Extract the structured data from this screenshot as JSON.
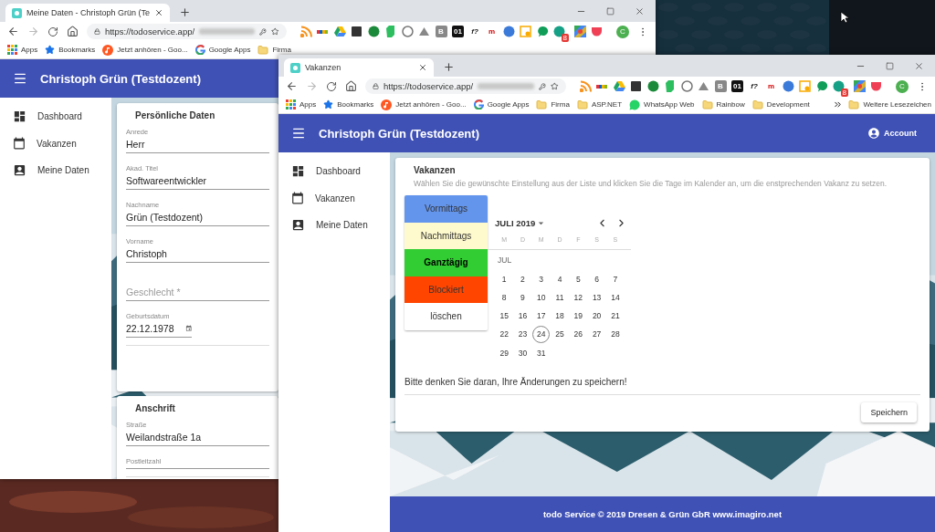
{
  "windows": [
    {
      "tab_title": "Meine Daten - Christoph Grün (Te",
      "url": "https://todoservice.app/",
      "avatar": "C",
      "extensions": [
        {
          "kind": "rss"
        },
        {
          "kind": "bars"
        },
        {
          "kind": "triangle"
        },
        {
          "kind": "dark-square"
        },
        {
          "kind": "green-circle"
        },
        {
          "kind": "leaf"
        },
        {
          "kind": "grey-circle"
        },
        {
          "kind": "cloud"
        },
        {
          "kind": "tile",
          "label": "B"
        },
        {
          "kind": "dark-tile",
          "label": "01"
        },
        {
          "kind": "italic",
          "label": "f?"
        },
        {
          "kind": "red",
          "label": "m"
        },
        {
          "kind": "globe"
        },
        {
          "kind": "yellow-square"
        },
        {
          "kind": "bubble"
        },
        {
          "kind": "badge",
          "label": "8"
        },
        {
          "kind": "colorful"
        },
        {
          "kind": "pocket"
        }
      ],
      "bookmarks": [
        {
          "kind": "apps",
          "label": "Apps"
        },
        {
          "kind": "star",
          "label": "Bookmarks"
        },
        {
          "kind": "music",
          "label": "Jetzt anhören - Goo..."
        },
        {
          "kind": "google",
          "label": "Google Apps"
        },
        {
          "kind": "folder",
          "label": "Firma"
        }
      ],
      "app_title": "Christoph Grün (Testdozent)",
      "nav": [
        {
          "kind": "dashboard",
          "label": "Dashboard"
        },
        {
          "kind": "calendar",
          "label": "Vakanzen"
        },
        {
          "kind": "person",
          "label": "Meine Daten"
        }
      ],
      "page": {
        "kind": "profile",
        "cards": [
          {
            "title": "Persönliche Daten",
            "fields": [
              {
                "kind": "text",
                "label": "Anrede",
                "value": "Herr"
              },
              {
                "kind": "text",
                "label": "Akad. Titel",
                "value": "Softwareentwickler"
              },
              {
                "kind": "text",
                "label": "Nachname",
                "value": "Grün (Testdozent)"
              },
              {
                "kind": "text",
                "label": "Vorname",
                "value": "Christoph"
              },
              {
                "kind": "select",
                "placeholder": "Geschlecht *"
              },
              {
                "kind": "date",
                "label": "Geburtsdatum",
                "value": "22.12.1978"
              }
            ]
          },
          {
            "title": "Anschrift",
            "fields": [
              {
                "kind": "text",
                "label": "Straße",
                "value": "Weilandstraße 1a"
              },
              {
                "kind": "text",
                "label": "Postleitzahl"
              }
            ]
          }
        ]
      }
    },
    {
      "tab_title": "Vakanzen",
      "url": "https://todoservice.app/",
      "avatar": "C",
      "extensions": [
        {
          "kind": "rss"
        },
        {
          "kind": "bars"
        },
        {
          "kind": "triangle"
        },
        {
          "kind": "dark-square"
        },
        {
          "kind": "green-circle"
        },
        {
          "kind": "leaf"
        },
        {
          "kind": "grey-circle"
        },
        {
          "kind": "cloud"
        },
        {
          "kind": "tile",
          "label": "B"
        },
        {
          "kind": "dark-tile",
          "label": "01"
        },
        {
          "kind": "italic",
          "label": "f?"
        },
        {
          "kind": "red",
          "label": "m"
        },
        {
          "kind": "globe"
        },
        {
          "kind": "yellow-square"
        },
        {
          "kind": "bubble"
        },
        {
          "kind": "badge",
          "label": "8"
        },
        {
          "kind": "colorful"
        },
        {
          "kind": "pocket"
        }
      ],
      "bookmarks": [
        {
          "kind": "apps",
          "label": "Apps"
        },
        {
          "kind": "star",
          "label": "Bookmarks"
        },
        {
          "kind": "music",
          "label": "Jetzt anhören - Goo..."
        },
        {
          "kind": "google",
          "label": "Google Apps"
        },
        {
          "kind": "folder",
          "label": "Firma"
        },
        {
          "kind": "folder",
          "label": "ASP.NET"
        },
        {
          "kind": "whatsapp",
          "label": "WhatsApp Web"
        },
        {
          "kind": "folder",
          "label": "Rainbow"
        },
        {
          "kind": "folder",
          "label": "Development"
        }
      ],
      "other_bookmarks": "Weitere Lesezeichen",
      "app_title": "Christoph Grün (Testdozent)",
      "account": "Account",
      "nav": [
        {
          "kind": "dashboard",
          "label": "Dashboard"
        },
        {
          "kind": "calendar",
          "label": "Vakanzen"
        },
        {
          "kind": "person",
          "label": "Meine Daten"
        }
      ],
      "page": {
        "kind": "vacancies",
        "title": "Vakanzen",
        "description": "Wählen Sie die gewünschte Einstellung aus der Liste und klicken Sie die Tage im Kalender an, um die enstprechenden Vakanz zu setzen.",
        "options": [
          {
            "label": "Vormittags",
            "color": "#6495ed",
            "selected": false
          },
          {
            "label": "Nachmittags",
            "color": "#fffacd",
            "selected": false
          },
          {
            "label": "Ganztägig",
            "color": "#32cd32",
            "selected": true
          },
          {
            "label": "Blockiert",
            "color": "#ff4500",
            "selected": false
          },
          {
            "label": "löschen",
            "color": "#ffffff",
            "selected": false
          }
        ],
        "calendar": {
          "month": "JULI 2019",
          "weekdays": [
            "M",
            "D",
            "M",
            "D",
            "F",
            "S",
            "S"
          ],
          "month_short": "JUL",
          "days": [
            {
              "day": "1",
              "today": false
            },
            {
              "day": "2",
              "today": false
            },
            {
              "day": "3",
              "today": false
            },
            {
              "day": "4",
              "today": false
            },
            {
              "day": "5",
              "today": false
            },
            {
              "day": "6",
              "today": false
            },
            {
              "day": "7",
              "today": false
            },
            {
              "day": "8",
              "today": false
            },
            {
              "day": "9",
              "today": false
            },
            {
              "day": "10",
              "today": false
            },
            {
              "day": "11",
              "today": false
            },
            {
              "day": "12",
              "today": false
            },
            {
              "day": "13",
              "today": false
            },
            {
              "day": "14",
              "today": false
            },
            {
              "day": "15",
              "today": false
            },
            {
              "day": "16",
              "today": false
            },
            {
              "day": "17",
              "today": false
            },
            {
              "day": "18",
              "today": false
            },
            {
              "day": "19",
              "today": false
            },
            {
              "day": "20",
              "today": false
            },
            {
              "day": "21",
              "today": false
            },
            {
              "day": "22",
              "today": false
            },
            {
              "day": "23",
              "today": false
            },
            {
              "day": "24",
              "today": true
            },
            {
              "day": "25",
              "today": false
            },
            {
              "day": "26",
              "today": false
            },
            {
              "day": "27",
              "today": false
            },
            {
              "day": "28",
              "today": false
            },
            {
              "day": "29",
              "today": false
            },
            {
              "day": "30",
              "today": false
            },
            {
              "day": "31",
              "today": false
            }
          ]
        },
        "note": "Bitte denken Sie daran, Ihre Änderungen zu speichern!",
        "save_button": "Speichern"
      },
      "footer": "todo Service © 2019 Dresen & Grün GbR www.imagiro.net"
    }
  ]
}
